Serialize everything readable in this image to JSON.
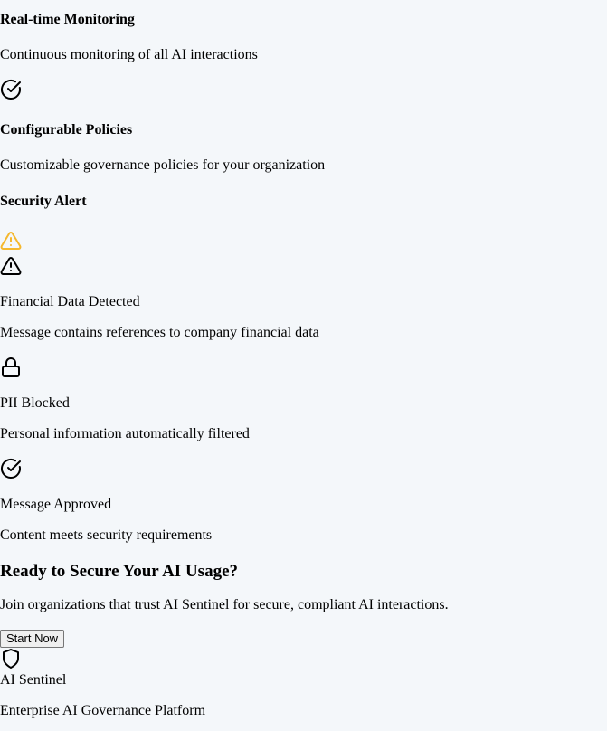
{
  "features": {
    "monitoring": {
      "title": "Real-time Monitoring",
      "description": "Continuous monitoring of all AI interactions",
      "icon": "check-circle-icon"
    },
    "policies": {
      "title": "Configurable Policies",
      "description": "Customizable governance policies for your organization",
      "icon": "check-circle-icon"
    }
  },
  "alerts": {
    "heading": "Security Alert",
    "header_icon": "warning-icon",
    "header_icon_color": "#f5b82e",
    "items": [
      {
        "icon": "warning-icon",
        "title": "Financial Data Detected",
        "description": "Message contains references to company financial data"
      },
      {
        "icon": "lock-icon",
        "title": "PII Blocked",
        "description": "Personal information automatically filtered"
      },
      {
        "icon": "check-circle-icon",
        "title": "Message Approved",
        "description": "Content meets security requirements"
      }
    ]
  },
  "cta": {
    "heading": "Ready to Secure Your AI Usage?",
    "description": "Join organizations that trust AI Sentinel for secure, compliant AI interactions.",
    "button_label": "Start Now"
  },
  "footer": {
    "icon": "shield-icon",
    "brand": "AI Sentinel",
    "tagline": "Enterprise AI Governance Platform"
  }
}
